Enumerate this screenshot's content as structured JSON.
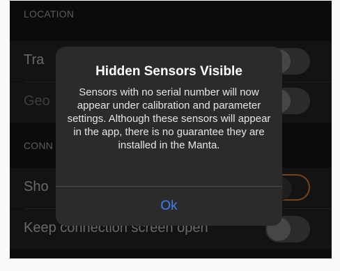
{
  "sections": {
    "location": {
      "header": "LOCATION",
      "rows": [
        {
          "label": "Tra"
        },
        {
          "label": "Geo"
        }
      ]
    },
    "connection": {
      "header": "CONN",
      "rows": [
        {
          "label": "Sho"
        },
        {
          "label": "Keep connection screen open"
        }
      ]
    }
  },
  "alert": {
    "title": "Hidden Sensors Visible",
    "message": "Sensors with no serial number will now appear under calibration and parameter settings.  Although these sensors will appear in the app, there is no guarantee they are installed in the Manta.",
    "button": "Ok"
  },
  "colors": {
    "background": "#0f0f0f",
    "accent": "#3b82f6",
    "toggle_on_outline": "#a0581f"
  }
}
